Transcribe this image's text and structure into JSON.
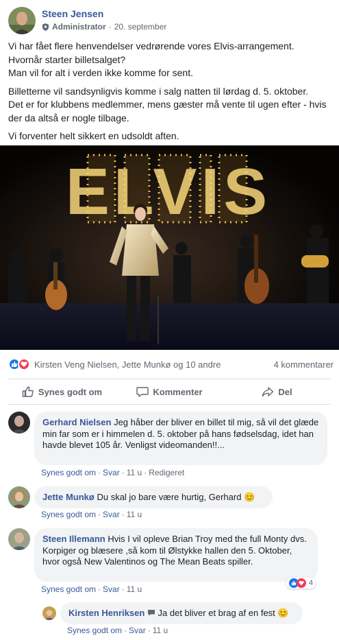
{
  "post": {
    "author": "Steen Jensen",
    "role": "Administrator",
    "date": "20. september",
    "paragraphs": [
      "Vi har fået flere henvendelser vedrørende vores Elvis-arrangement.\nHvornår starter billetsalget?\nMan vil for alt i verden ikke komme for sent.",
      "Billetterne vil sandsynligvis komme i salg natten til lørdag d. 5. oktober.\nDet er for klubbens medlemmer, mens gæster må vente til ugen efter - hvis der da altså er nogle tilbage.",
      "Vi forventer helt sikkert en udsoldt aften."
    ],
    "photo_sign": "ELVIS"
  },
  "reactions": {
    "names": "Kirsten Veng Nielsen, Jette Munkø og 10 andre",
    "comments_count": "4 kommentarer",
    "like_color": "#1877f2",
    "love_color": "#f33e58"
  },
  "actions": {
    "like": "Synes godt om",
    "comment": "Kommenter",
    "share": "Del"
  },
  "comments": [
    {
      "name": "Gerhard Nielsen",
      "text": "Jeg håber der bliver en billet til mig, så vil det glæde min far som er i himmelen d. 5. oktober på hans fødselsdag, idet han havde blevet 105 år. Venligst videomanden!!...",
      "like": "Synes godt om",
      "reply": "Svar",
      "time": "11 u",
      "edited": "Redigeret"
    },
    {
      "name": "Jette Munkø",
      "text": "Du skal jo bare være hurtig, Gerhard 😊",
      "like": "Synes godt om",
      "reply": "Svar",
      "time": "11 u"
    },
    {
      "name": "Steen Illemann",
      "text": "Hvis I vil opleve Brian Troy med the full Monty dvs. Korpiger og blæsere ,så kom til Ølstykke hallen den 5. Oktober, hvor også New Valentinos og The Mean Beats spiller.",
      "like": "Synes godt om",
      "reply": "Svar",
      "time": "11 u",
      "reaction_count": "4"
    },
    {
      "name": "Kirsten Henriksen",
      "text": "Ja det bliver et brag af en fest 😊",
      "like": "Synes godt om",
      "reply": "Svar",
      "time": "11 u"
    }
  ]
}
